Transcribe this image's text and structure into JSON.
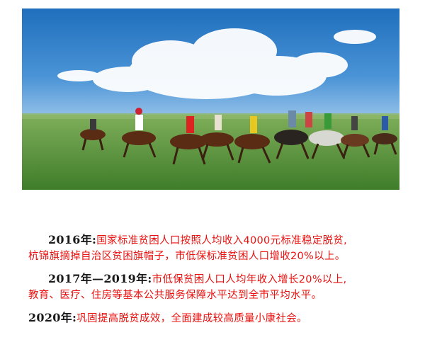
{
  "photo": {
    "subject": "horse-racers-on-grassland",
    "colors": {
      "sky": "#2f7fc4",
      "cloud": "#ffffff",
      "grass": "#5f9b3a",
      "accent_text": "#e8110f",
      "year_text": "#1a1a1a"
    }
  },
  "paragraphs": [
    {
      "year": "2016年:",
      "line1": "国家标准贫困人口按照人均收入4000元标准稳定脱贫,",
      "line2": "杭锦旗摘掉自治区贫困旗帽子，市低保标准贫困人口增收20%以上。"
    },
    {
      "year": "2017年—2019年:",
      "line1": "市低保贫困人口人均年收入增长20%以上,",
      "line2": "教育、医疗、住房等基本公共服务保障水平达到全市平均水平。"
    },
    {
      "year": "2020年:",
      "line1": "巩固提高脱贫成效，全面建成较高质量小康社会。"
    }
  ]
}
